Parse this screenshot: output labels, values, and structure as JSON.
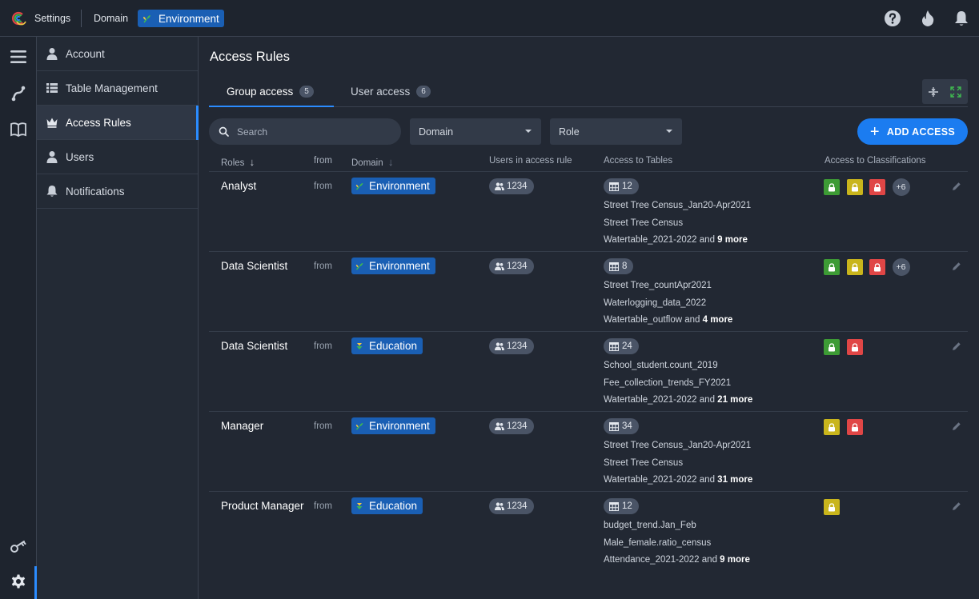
{
  "header": {
    "settings_label": "Settings",
    "domain_label": "Domain",
    "environment_label": "Environment"
  },
  "colors": {
    "accent": "#1b7cf0",
    "domain_chip": "#1a5fb4",
    "cls_green": "#3d9b35",
    "cls_yellow": "#c9b51c",
    "cls_red": "#e04646"
  },
  "sidebar": {
    "items": [
      {
        "label": "Account",
        "icon": "person-icon"
      },
      {
        "label": "Table Management",
        "icon": "list-icon"
      },
      {
        "label": "Access Rules",
        "icon": "crown-icon",
        "active": true
      },
      {
        "label": "Users",
        "icon": "person-icon"
      },
      {
        "label": "Notifications",
        "icon": "bell-icon"
      }
    ]
  },
  "main": {
    "title": "Access Rules",
    "tabs": [
      {
        "label": "Group access",
        "count": "5",
        "active": true
      },
      {
        "label": "User access",
        "count": "6"
      }
    ],
    "search_placeholder": "Search",
    "filters": {
      "domain": "Domain",
      "role": "Role"
    },
    "add_button": "ADD ACCESS",
    "columns": {
      "roles": "Roles",
      "from": "from",
      "domain": "Domain",
      "users": "Users in access rule",
      "tables": "Access to Tables",
      "classifications": "Access to Classifications"
    },
    "rows": [
      {
        "role": "Analyst",
        "from": "from",
        "domain": "Environment",
        "domain_icon": "sprout-icon",
        "users": "1234",
        "tables_count": "12",
        "tables": [
          "Street Tree Census_Jan20-Apr2021",
          "Street Tree Census"
        ],
        "tables_last": "Watertable_2021-2022",
        "and_label": "and",
        "more": "9 more",
        "classifications": [
          "green",
          "yellow",
          "red"
        ],
        "cls_more": "+6"
      },
      {
        "role": "Data Scientist",
        "from": "from",
        "domain": "Environment",
        "domain_icon": "sprout-icon",
        "users": "1234",
        "tables_count": "8",
        "tables": [
          "Street Tree_countApr2021",
          "Waterlogging_data_2022"
        ],
        "tables_last": "Watertable_outflow",
        "and_label": "and",
        "more": "4 more",
        "classifications": [
          "green",
          "yellow",
          "red"
        ],
        "cls_more": "+6"
      },
      {
        "role": "Data Scientist",
        "from": "from",
        "domain": "Education",
        "domain_icon": "education-icon",
        "users": "1234",
        "tables_count": "24",
        "tables": [
          "School_student.count_2019",
          "Fee_collection_trends_FY2021"
        ],
        "tables_last": "Watertable_2021-2022",
        "and_label": "and",
        "more": "21 more",
        "classifications": [
          "green",
          "red"
        ],
        "cls_more": ""
      },
      {
        "role": "Manager",
        "from": "from",
        "domain": "Environment",
        "domain_icon": "sprout-icon",
        "users": "1234",
        "tables_count": "34",
        "tables": [
          "Street Tree Census_Jan20-Apr2021",
          "Street Tree Census"
        ],
        "tables_last": "Watertable_2021-2022",
        "and_label": "and",
        "more": "31 more",
        "classifications": [
          "yellow",
          "red"
        ],
        "cls_more": ""
      },
      {
        "role": "Product Manager",
        "from": "from",
        "domain": "Education",
        "domain_icon": "education-icon",
        "users": "1234",
        "tables_count": "12",
        "tables": [
          "budget_trend.Jan_Feb",
          "Male_female.ratio_census"
        ],
        "tables_last": "Attendance_2021-2022",
        "and_label": "and",
        "more": "9 more",
        "classifications": [
          "yellow"
        ],
        "cls_more": ""
      }
    ]
  }
}
